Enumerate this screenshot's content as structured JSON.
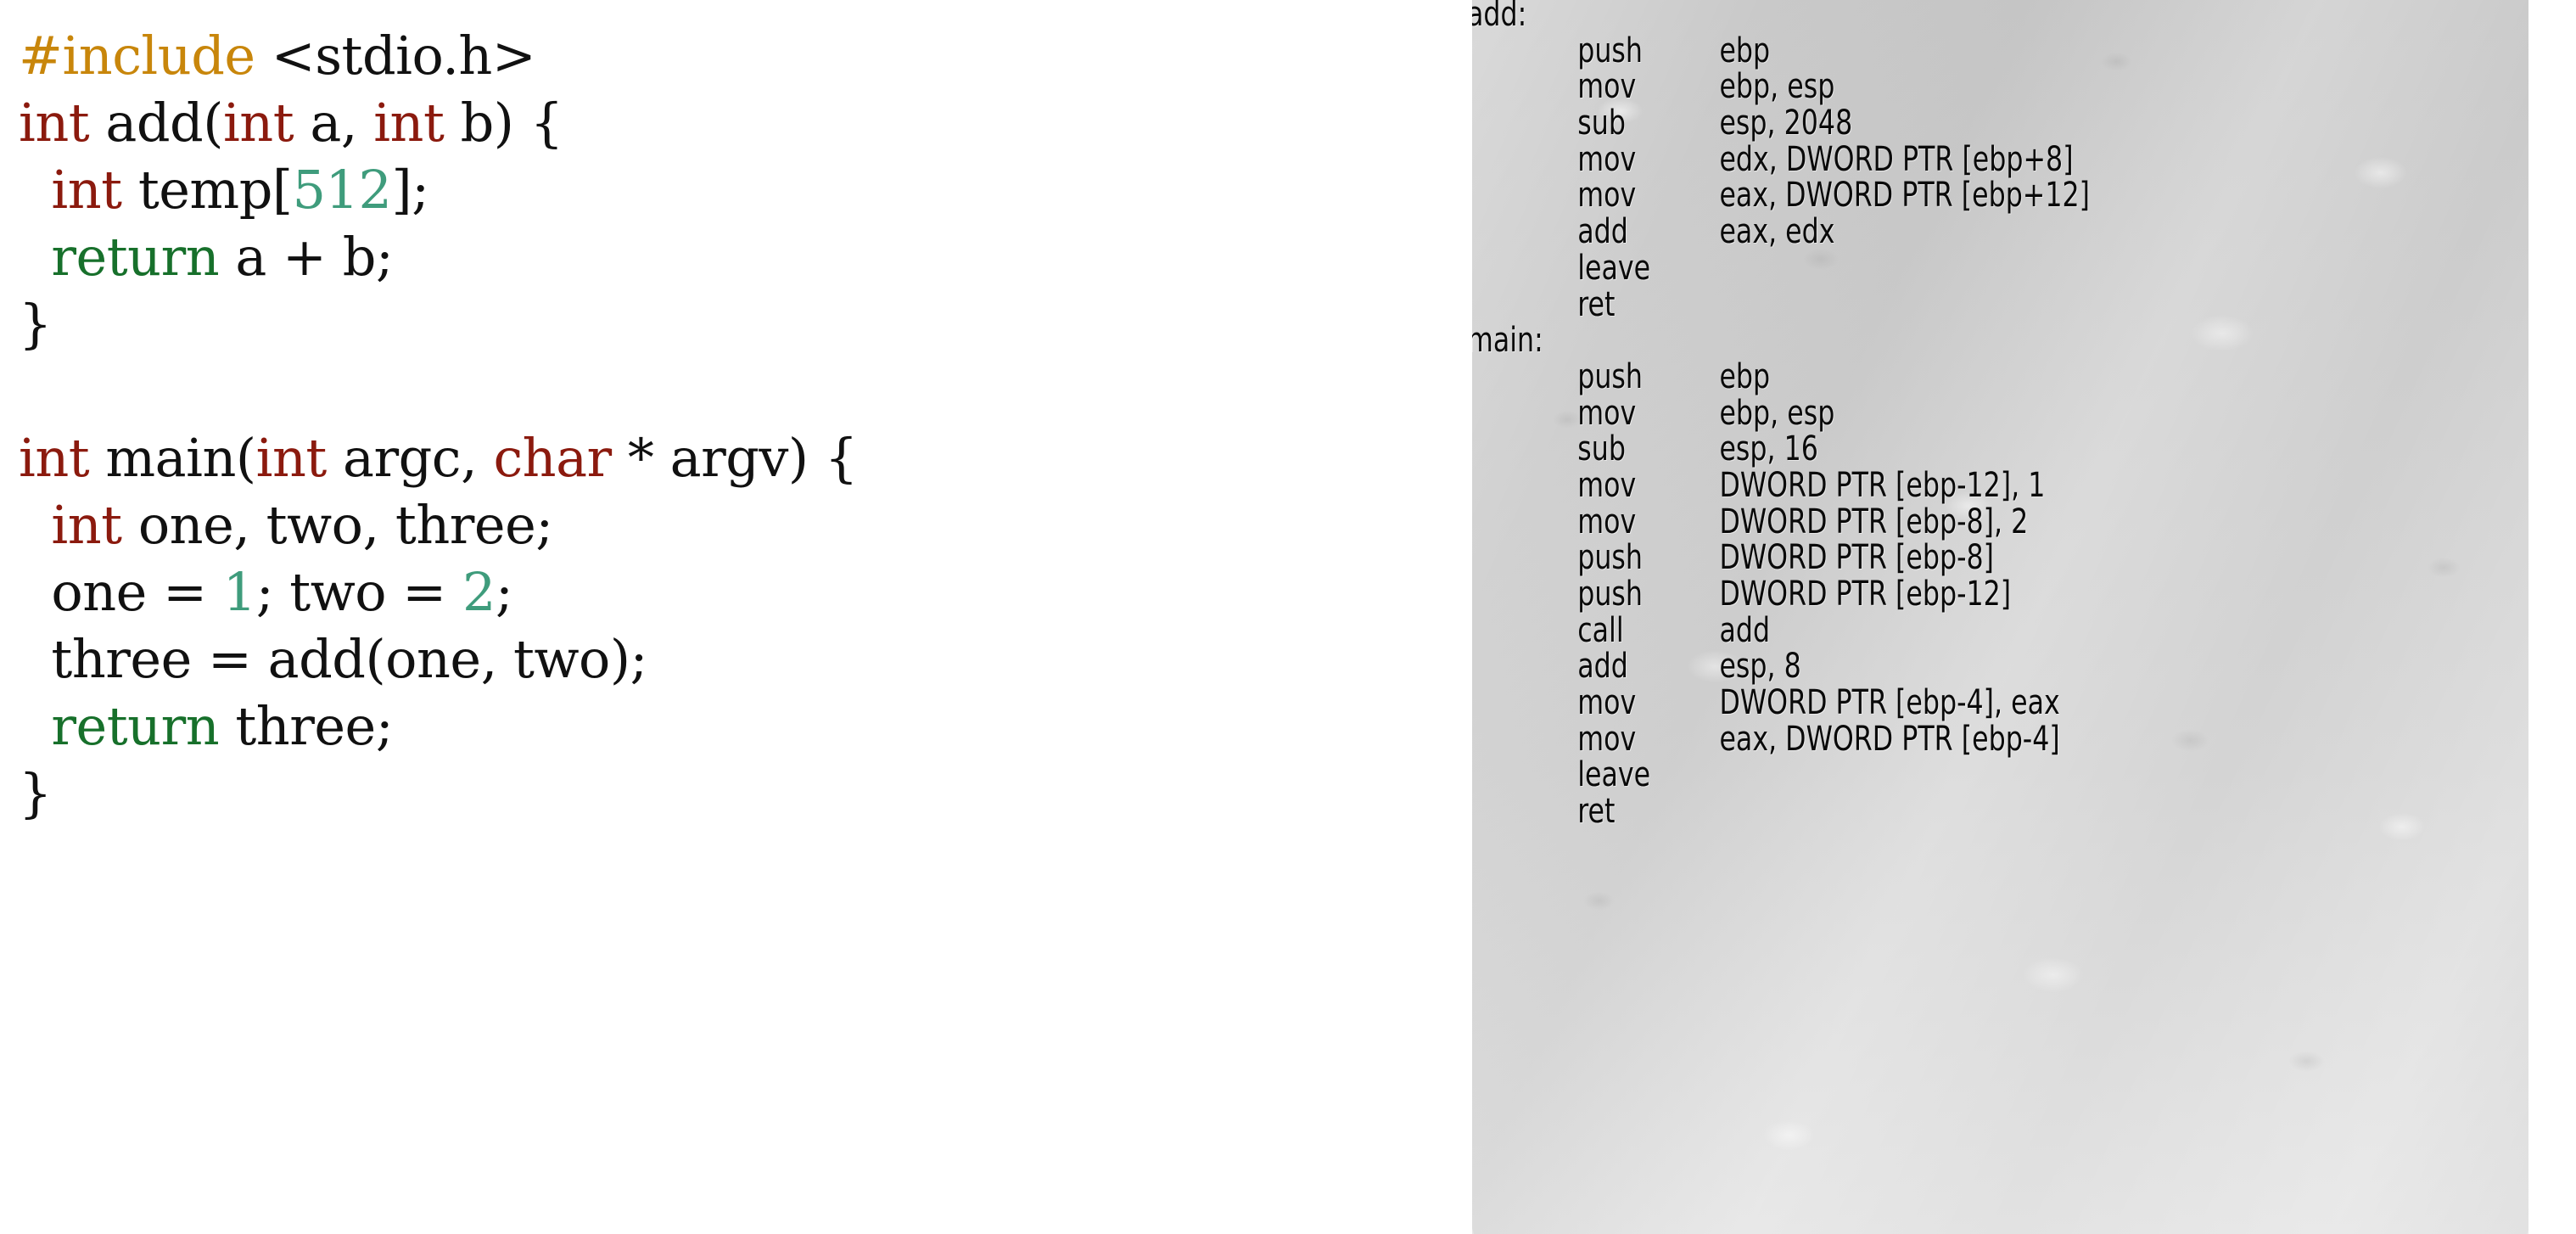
{
  "colors": {
    "preprocessor": "#C8860B",
    "type_keyword": "#8B1A0E",
    "control_keyword": "#17702B",
    "number_literal": "#3F9C7C",
    "plain_text": "#111111",
    "source_background": "#FFFFFF",
    "assembly_background": "#D2D2D2",
    "assembly_text": "#0A0A0A"
  },
  "source_panel": {
    "language": "C",
    "lines": [
      {
        "id": "line-include",
        "tokens": [
          {
            "text": "#include",
            "kind": "pre"
          },
          {
            "text": " <stdio.h>",
            "kind": "plain"
          }
        ]
      },
      {
        "id": "line-add-signature",
        "tokens": [
          {
            "text": "int",
            "kind": "type"
          },
          {
            "text": " add(",
            "kind": "plain"
          },
          {
            "text": "int",
            "kind": "type"
          },
          {
            "text": " a, ",
            "kind": "plain"
          },
          {
            "text": "int",
            "kind": "type"
          },
          {
            "text": " b) {",
            "kind": "plain"
          }
        ]
      },
      {
        "id": "line-temp-decl",
        "tokens": [
          {
            "text": "  ",
            "kind": "plain"
          },
          {
            "text": "int",
            "kind": "type"
          },
          {
            "text": " temp[",
            "kind": "plain"
          },
          {
            "text": "512",
            "kind": "num"
          },
          {
            "text": "];",
            "kind": "plain"
          }
        ]
      },
      {
        "id": "line-add-return",
        "tokens": [
          {
            "text": "  ",
            "kind": "plain"
          },
          {
            "text": "return",
            "kind": "kw"
          },
          {
            "text": " a + b;",
            "kind": "plain"
          }
        ]
      },
      {
        "id": "line-add-close",
        "tokens": [
          {
            "text": "}",
            "kind": "plain"
          }
        ]
      },
      {
        "id": "line-blank",
        "tokens": [
          {
            "text": "",
            "kind": "plain"
          }
        ]
      },
      {
        "id": "line-main-signature",
        "tokens": [
          {
            "text": "int",
            "kind": "type"
          },
          {
            "text": " main(",
            "kind": "plain"
          },
          {
            "text": "int",
            "kind": "type"
          },
          {
            "text": " argc, ",
            "kind": "plain"
          },
          {
            "text": "char",
            "kind": "type"
          },
          {
            "text": " * argv) {",
            "kind": "plain"
          }
        ]
      },
      {
        "id": "line-main-decls",
        "tokens": [
          {
            "text": "  ",
            "kind": "plain"
          },
          {
            "text": "int",
            "kind": "type"
          },
          {
            "text": " one, two, three;",
            "kind": "plain"
          }
        ]
      },
      {
        "id": "line-main-assign",
        "tokens": [
          {
            "text": "  one = ",
            "kind": "plain"
          },
          {
            "text": "1",
            "kind": "num"
          },
          {
            "text": "; two = ",
            "kind": "plain"
          },
          {
            "text": "2",
            "kind": "num"
          },
          {
            "text": ";",
            "kind": "plain"
          }
        ]
      },
      {
        "id": "line-main-call",
        "tokens": [
          {
            "text": "  three = add(one, two);",
            "kind": "plain"
          }
        ]
      },
      {
        "id": "line-main-return",
        "tokens": [
          {
            "text": "  ",
            "kind": "plain"
          },
          {
            "text": "return",
            "kind": "kw"
          },
          {
            "text": " three;",
            "kind": "plain"
          }
        ]
      },
      {
        "id": "line-main-close",
        "tokens": [
          {
            "text": "}",
            "kind": "plain"
          }
        ]
      }
    ]
  },
  "assembly_panel": {
    "architecture": "x86",
    "syntax": "Intel",
    "lines": [
      {
        "type": "label",
        "label": "add:"
      },
      {
        "type": "instruction",
        "mnemonic": "push",
        "operands": "ebp"
      },
      {
        "type": "instruction",
        "mnemonic": "mov",
        "operands": "ebp, esp"
      },
      {
        "type": "instruction",
        "mnemonic": "sub",
        "operands": "esp, 2048"
      },
      {
        "type": "instruction",
        "mnemonic": "mov",
        "operands": "edx, DWORD PTR [ebp+8]"
      },
      {
        "type": "instruction",
        "mnemonic": "mov",
        "operands": "eax, DWORD PTR [ebp+12]"
      },
      {
        "type": "instruction",
        "mnemonic": "add",
        "operands": "eax, edx"
      },
      {
        "type": "instruction",
        "mnemonic": "leave",
        "operands": ""
      },
      {
        "type": "instruction",
        "mnemonic": "ret",
        "operands": ""
      },
      {
        "type": "label",
        "label": "main:"
      },
      {
        "type": "instruction",
        "mnemonic": "push",
        "operands": "ebp"
      },
      {
        "type": "instruction",
        "mnemonic": "mov",
        "operands": "ebp, esp"
      },
      {
        "type": "instruction",
        "mnemonic": "sub",
        "operands": "esp, 16"
      },
      {
        "type": "instruction",
        "mnemonic": "mov",
        "operands": "DWORD PTR [ebp-12], 1"
      },
      {
        "type": "instruction",
        "mnemonic": "mov",
        "operands": "DWORD PTR [ebp-8], 2"
      },
      {
        "type": "instruction",
        "mnemonic": "push",
        "operands": "DWORD PTR [ebp-8]"
      },
      {
        "type": "instruction",
        "mnemonic": "push",
        "operands": "DWORD PTR [ebp-12]"
      },
      {
        "type": "instruction",
        "mnemonic": "call",
        "operands": "add"
      },
      {
        "type": "instruction",
        "mnemonic": "add",
        "operands": "esp, 8"
      },
      {
        "type": "instruction",
        "mnemonic": "mov",
        "operands": "DWORD PTR [ebp-4], eax"
      },
      {
        "type": "instruction",
        "mnemonic": "mov",
        "operands": "eax, DWORD PTR [ebp-4]"
      },
      {
        "type": "instruction",
        "mnemonic": "leave",
        "operands": ""
      },
      {
        "type": "instruction",
        "mnemonic": "ret",
        "operands": ""
      }
    ]
  }
}
